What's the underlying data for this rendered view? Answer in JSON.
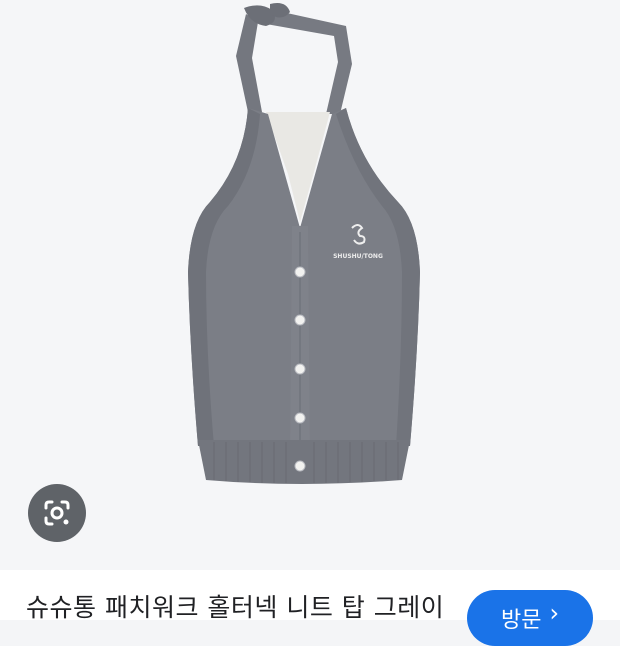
{
  "product": {
    "title": "슈슈통 패치워크 홀터넥 니트 탑 그레이",
    "brand_mark": "SHUSHU/TONG",
    "image_icon": "gray-halter-knit-top-image"
  },
  "actions": {
    "visit_label": "방문",
    "visit_icon": "chevron-right-icon",
    "lens_icon": "google-lens-icon"
  },
  "colors": {
    "accent": "#1a73e8",
    "garment": "#7b7e86",
    "lens_button": "#5f6368"
  }
}
